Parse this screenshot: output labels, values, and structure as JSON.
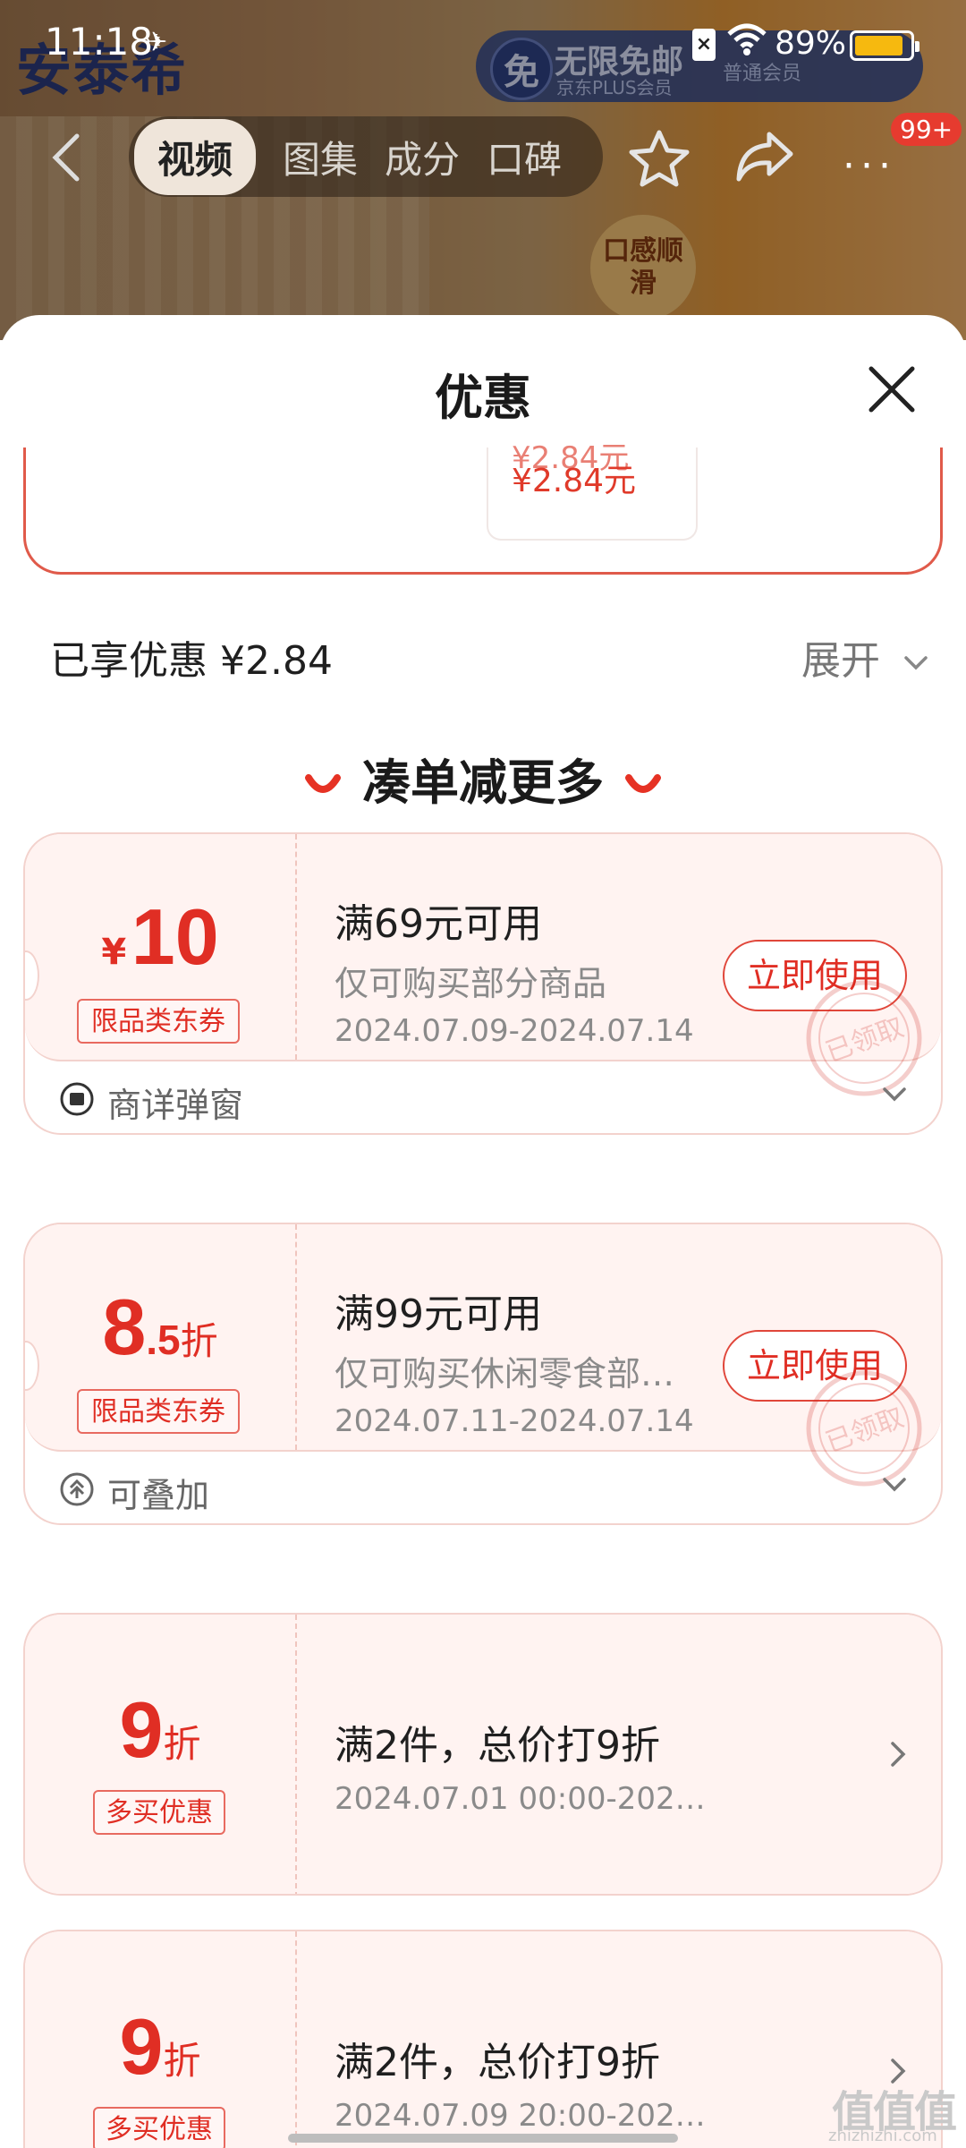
{
  "status_bar": {
    "time": "11:18",
    "battery": "89%",
    "battery_level": 0.89
  },
  "background": {
    "brand": "安泰希",
    "plus_title": "无限免邮",
    "plus_icon": "免",
    "plus_sub": "京东PLUS会员",
    "plus_right": "普通会员",
    "badge": "口感顺滑"
  },
  "nav": {
    "tabs": [
      {
        "label": "视频",
        "active": true
      },
      {
        "label": "图集"
      },
      {
        "label": "成分"
      },
      {
        "label": "口碑"
      }
    ],
    "more": "···",
    "message_count": "99+"
  },
  "sheet": {
    "title": "优惠",
    "partial_price_clip": "¥2.84元",
    "partial_price": "¥2.84元",
    "enjoyed": "已享优惠 ¥2.84",
    "expand": "展开",
    "section_title": "凑单减更多"
  },
  "coupons": [
    {
      "yen": "¥",
      "amount": "10",
      "tag": "限品类东券",
      "condition": "满69元可用",
      "desc": "仅可购买部分商品",
      "date": "2024.07.09-2024.07.14",
      "button": "立即使用",
      "stamp": "已领取",
      "footer": "商详弹窗"
    },
    {
      "amount_big": "8",
      "amount_small": ".5",
      "unit": "折",
      "tag": "限品类东券",
      "condition": "满99元可用",
      "desc": "仅可购买休闲零食部…",
      "date": "2024.07.11-2024.07.14",
      "button": "立即使用",
      "stamp": "已领取",
      "footer": "可叠加"
    },
    {
      "amount": "9",
      "unit": "折",
      "tag": "多买优惠",
      "condition": "满2件，总价打9折",
      "date": "2024.07.01 00:00-202…"
    },
    {
      "amount": "9",
      "unit": "折",
      "tag": "多买优惠",
      "condition": "满2件，总价打9折",
      "date": "2024.07.09 20:00-202…"
    }
  ],
  "watermark": {
    "main": "值值值",
    "sub": "zhizhizhi.com"
  },
  "colors": {
    "accent": "#e02e24",
    "card_bg": "#fff3f1",
    "card_border": "#f3d2cd"
  }
}
